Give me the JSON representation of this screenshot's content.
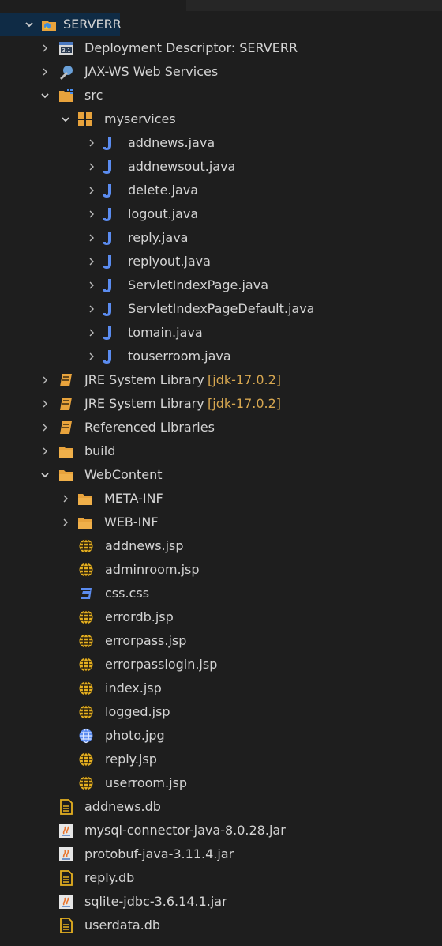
{
  "colors": {
    "background": "#1e1e1e",
    "text": "#d4d4d4",
    "decoration": "#d7a750",
    "selection": "#0f2b45",
    "folder": "#e8a33c",
    "java_icon": "#5b8cf0",
    "jsp_icon": "#e5b020"
  },
  "tree": [
    {
      "label": "SERVERR",
      "level": 0,
      "arrow": "down",
      "icon": "project-icon",
      "selected": true
    },
    {
      "label": "Deployment Descriptor: SERVERR",
      "level": 1,
      "arrow": "right",
      "icon": "deployment-descriptor-icon"
    },
    {
      "label": "JAX-WS Web Services",
      "level": 1,
      "arrow": "right",
      "icon": "web-services-icon"
    },
    {
      "label": "src",
      "level": 1,
      "arrow": "down",
      "icon": "source-folder-icon"
    },
    {
      "label": "myservices",
      "level": 2,
      "arrow": "down",
      "icon": "package-icon"
    },
    {
      "label": "addnews.java",
      "level": 3,
      "arrow": "right",
      "icon": "java-file-icon"
    },
    {
      "label": "addnewsout.java",
      "level": 3,
      "arrow": "right",
      "icon": "java-file-icon"
    },
    {
      "label": "delete.java",
      "level": 3,
      "arrow": "right",
      "icon": "java-file-icon"
    },
    {
      "label": "logout.java",
      "level": 3,
      "arrow": "right",
      "icon": "java-file-icon"
    },
    {
      "label": "reply.java",
      "level": 3,
      "arrow": "right",
      "icon": "java-file-icon"
    },
    {
      "label": "replyout.java",
      "level": 3,
      "arrow": "right",
      "icon": "java-file-icon"
    },
    {
      "label": "ServletIndexPage.java",
      "level": 3,
      "arrow": "right",
      "icon": "java-file-icon"
    },
    {
      "label": "ServletIndexPageDefault.java",
      "level": 3,
      "arrow": "right",
      "icon": "java-file-icon"
    },
    {
      "label": "tomain.java",
      "level": 3,
      "arrow": "right",
      "icon": "java-file-icon"
    },
    {
      "label": "touserroom.java",
      "level": 3,
      "arrow": "right",
      "icon": "java-file-icon"
    },
    {
      "label": "JRE System Library",
      "decoration": "[jdk-17.0.2]",
      "level": 1,
      "arrow": "right",
      "icon": "library-icon"
    },
    {
      "label": "JRE System Library",
      "decoration": "[jdk-17.0.2]",
      "level": 1,
      "arrow": "right",
      "icon": "library-icon"
    },
    {
      "label": "Referenced Libraries",
      "level": 1,
      "arrow": "right",
      "icon": "library-icon"
    },
    {
      "label": "build",
      "level": 1,
      "arrow": "right",
      "icon": "folder-icon"
    },
    {
      "label": "WebContent",
      "level": 1,
      "arrow": "down",
      "icon": "folder-icon"
    },
    {
      "label": "META-INF",
      "level": 2,
      "arrow": "right",
      "icon": "folder-icon"
    },
    {
      "label": "WEB-INF",
      "level": 2,
      "arrow": "right",
      "icon": "folder-icon"
    },
    {
      "label": "addnews.jsp",
      "level": 2,
      "arrow": "none",
      "icon": "jsp-file-icon"
    },
    {
      "label": "adminroom.jsp",
      "level": 2,
      "arrow": "none",
      "icon": "jsp-file-icon"
    },
    {
      "label": "css.css",
      "level": 2,
      "arrow": "none",
      "icon": "css-file-icon"
    },
    {
      "label": "errordb.jsp",
      "level": 2,
      "arrow": "none",
      "icon": "jsp-file-icon"
    },
    {
      "label": "errorpass.jsp",
      "level": 2,
      "arrow": "none",
      "icon": "jsp-file-icon"
    },
    {
      "label": "errorpasslogin.jsp",
      "level": 2,
      "arrow": "none",
      "icon": "jsp-file-icon"
    },
    {
      "label": "index.jsp",
      "level": 2,
      "arrow": "none",
      "icon": "jsp-file-icon"
    },
    {
      "label": "logged.jsp",
      "level": 2,
      "arrow": "none",
      "icon": "jsp-file-icon"
    },
    {
      "label": "photo.jpg",
      "level": 2,
      "arrow": "none",
      "icon": "image-file-icon"
    },
    {
      "label": "reply.jsp",
      "level": 2,
      "arrow": "none",
      "icon": "jsp-file-icon"
    },
    {
      "label": "userroom.jsp",
      "level": 2,
      "arrow": "none",
      "icon": "jsp-file-icon"
    },
    {
      "label": "addnews.db",
      "level": 1,
      "arrow": "none",
      "icon": "text-file-icon"
    },
    {
      "label": "mysql-connector-java-8.0.28.jar",
      "level": 1,
      "arrow": "none",
      "icon": "jar-file-icon"
    },
    {
      "label": "protobuf-java-3.11.4.jar",
      "level": 1,
      "arrow": "none",
      "icon": "jar-file-icon"
    },
    {
      "label": "reply.db",
      "level": 1,
      "arrow": "none",
      "icon": "text-file-icon"
    },
    {
      "label": "sqlite-jdbc-3.6.14.1.jar",
      "level": 1,
      "arrow": "none",
      "icon": "jar-file-icon"
    },
    {
      "label": "userdata.db",
      "level": 1,
      "arrow": "none",
      "icon": "text-file-icon"
    }
  ]
}
